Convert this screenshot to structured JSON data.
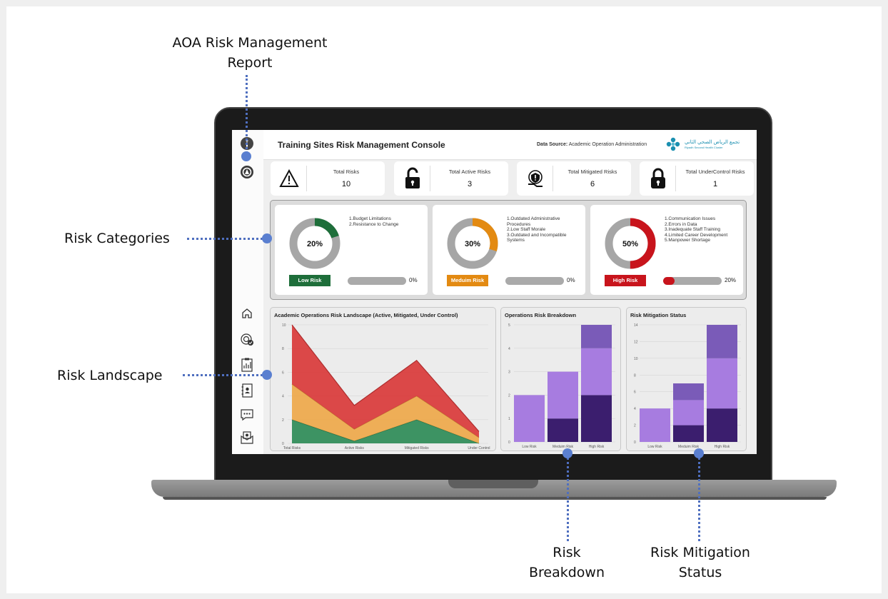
{
  "callouts": {
    "report_line1": "AOA Risk Management",
    "report_line2": "Report",
    "categories": "Risk Categories",
    "landscape": "Risk Landscape",
    "breakdown_line1": "Risk",
    "breakdown_line2": "Breakdown",
    "mitigation_line1": "Risk Mitigation",
    "mitigation_line2": "Status"
  },
  "header": {
    "title": "Training Sites Risk Management Console",
    "data_source_label": "Data Source:",
    "data_source_value": "Academic Operation Administration",
    "logo_ar": "تجمع الرياض الصحي الثاني",
    "logo_en": "Riyadh Second Health Cluster"
  },
  "sidebar": {
    "top_icons": [
      "info-icon",
      "settings-gear-icon"
    ],
    "nav_icons": [
      "home-icon",
      "target-check-icon",
      "clipboard-chart-icon",
      "contact-book-icon",
      "chat-bubble-icon",
      "mail-badge-icon"
    ]
  },
  "kpis": [
    {
      "label": "Total Risks",
      "value": "10",
      "icon": "warning-triangle-icon"
    },
    {
      "label": "Total Active Risks",
      "value": "3",
      "icon": "unlocked-padlock-icon"
    },
    {
      "label": "Total Mitigated Risks",
      "value": "6",
      "icon": "shield-hand-icon"
    },
    {
      "label": "Total UnderControl Risks",
      "value": "1",
      "icon": "locked-padlock-icon"
    }
  ],
  "categories": [
    {
      "donut_pct": "20%",
      "donut_fraction": 0.2,
      "color": "#1e6e3a",
      "items": [
        "1.Budget Limitations",
        "2.Resistance to Change"
      ],
      "badge": "Low Risk",
      "bar_pct": "0%",
      "bar_fraction": 0
    },
    {
      "donut_pct": "30%",
      "donut_fraction": 0.3,
      "color": "#e38a12",
      "items": [
        "1.Outdated Administrative Procedures",
        "2.Low Staff Morale",
        "3.Outdated and Incompatible Systems"
      ],
      "badge": "Meduim Risk",
      "bar_pct": "0%",
      "bar_fraction": 0
    },
    {
      "donut_pct": "50%",
      "donut_fraction": 0.5,
      "color": "#c8141c",
      "items": [
        "1.Communication Issues",
        "2.Errors in Data",
        "3.Inadequate Staff Training",
        "4.Limited Career Development",
        "5.Manpower Shortage"
      ],
      "badge": "High Risk",
      "bar_pct": "20%",
      "bar_fraction": 0.2
    }
  ],
  "chart_data": [
    {
      "type": "area",
      "title": "Academic Operations Risk Landscape (Active, Mitigated, Under Control)",
      "categories": [
        "Total Risks",
        "Active Risks",
        "Mitigated Risks",
        "Under Control"
      ],
      "ylim": [
        0,
        10
      ],
      "yticks": [
        "0",
        "2",
        "4",
        "6",
        "8",
        "10"
      ],
      "series": [
        {
          "values": [
            2,
            0.2,
            2,
            0
          ],
          "color": "#2e8b57"
        },
        {
          "values": [
            3,
            1,
            2,
            0.5
          ],
          "color": "#eea84a"
        },
        {
          "values": [
            5,
            2,
            3,
            0.5
          ],
          "color": "#d9393a"
        }
      ]
    },
    {
      "type": "bar",
      "title": "Operations Risk Breakdown",
      "categories": [
        "Low Risk",
        "Meduim Risk",
        "High Risk"
      ],
      "ylim": [
        0,
        5
      ],
      "yticks": [
        "0",
        "1",
        "2",
        "3",
        "4",
        "5"
      ],
      "series": [
        {
          "values": [
            0,
            1,
            2
          ],
          "color": "#3b1e6e"
        },
        {
          "values": [
            2,
            2,
            2
          ],
          "color": "#a77ce0"
        },
        {
          "values": [
            0,
            0,
            1
          ],
          "color": "#7a5bb8"
        }
      ]
    },
    {
      "type": "bar",
      "title": "Risk Mitigation Status",
      "categories": [
        "Low Risk",
        "Meduim Risk",
        "High Risk"
      ],
      "ylim": [
        0,
        14
      ],
      "yticks": [
        "0",
        "2",
        "4",
        "6",
        "8",
        "10",
        "12",
        "14"
      ],
      "series": [
        {
          "values": [
            0,
            2,
            4
          ],
          "color": "#3b1e6e"
        },
        {
          "values": [
            4,
            3,
            6
          ],
          "color": "#a77ce0"
        },
        {
          "values": [
            0,
            2,
            4
          ],
          "color": "#7a5bb8"
        }
      ]
    }
  ]
}
